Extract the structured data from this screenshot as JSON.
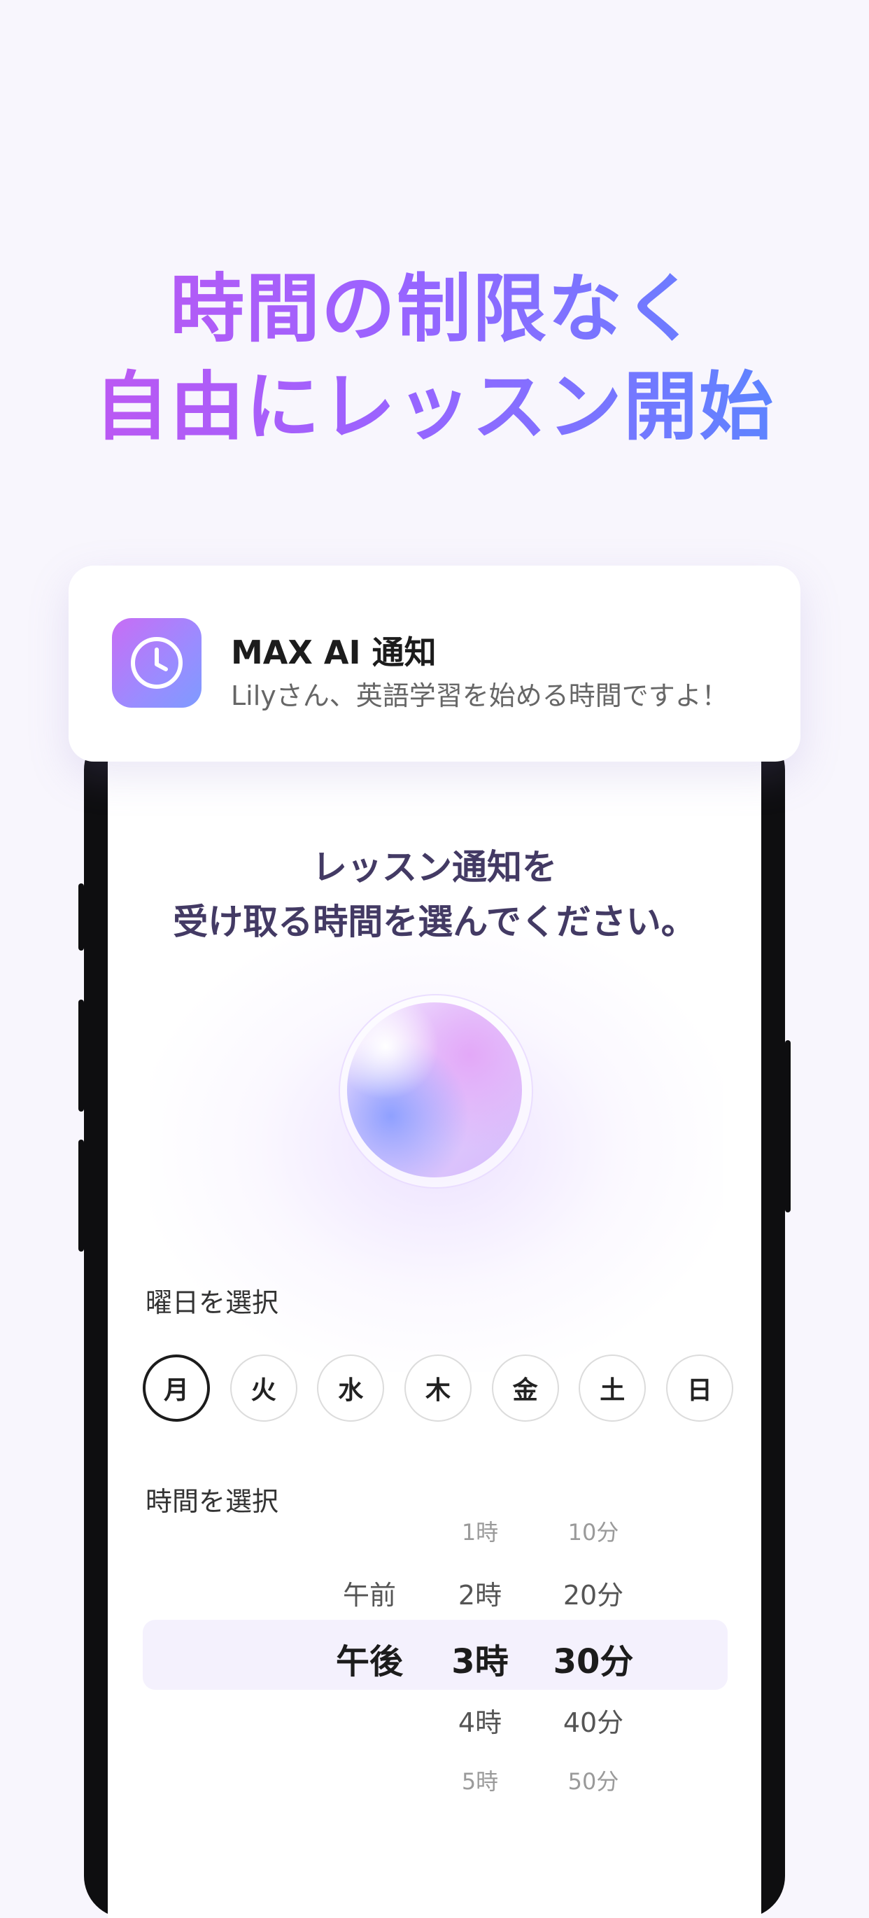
{
  "headline": {
    "line1": "時間の制限なく",
    "line2": "自由にレッスン開始"
  },
  "notification": {
    "icon": "clock-icon",
    "title": "MAX AI 通知",
    "body": "Lilyさん、英語学習を始める時間ですよ！"
  },
  "screen": {
    "prompt_line1": "レッスン通知を",
    "prompt_line2": "受け取る時間を選んでください。",
    "day_section_label": "曜日を選択",
    "days": [
      {
        "label": "月",
        "selected": true
      },
      {
        "label": "火",
        "selected": false
      },
      {
        "label": "水",
        "selected": false
      },
      {
        "label": "木",
        "selected": false
      },
      {
        "label": "金",
        "selected": false
      },
      {
        "label": "土",
        "selected": false
      },
      {
        "label": "日",
        "selected": false
      }
    ],
    "time_section_label": "時間を選択",
    "picker": {
      "ampm": {
        "options": [
          "午前",
          "午後"
        ],
        "selected": "午後"
      },
      "hours": {
        "options": [
          "1時",
          "2時",
          "3時",
          "4時",
          "5時"
        ],
        "selected": "3時"
      },
      "minutes": {
        "options": [
          "10分",
          "20分",
          "30分",
          "40分",
          "50分"
        ],
        "selected": "30分"
      }
    }
  },
  "colors": {
    "gradient_start": "#c655ef",
    "gradient_end": "#4f8cff",
    "background": "#f8f6fd",
    "prompt_text": "#433a64"
  }
}
